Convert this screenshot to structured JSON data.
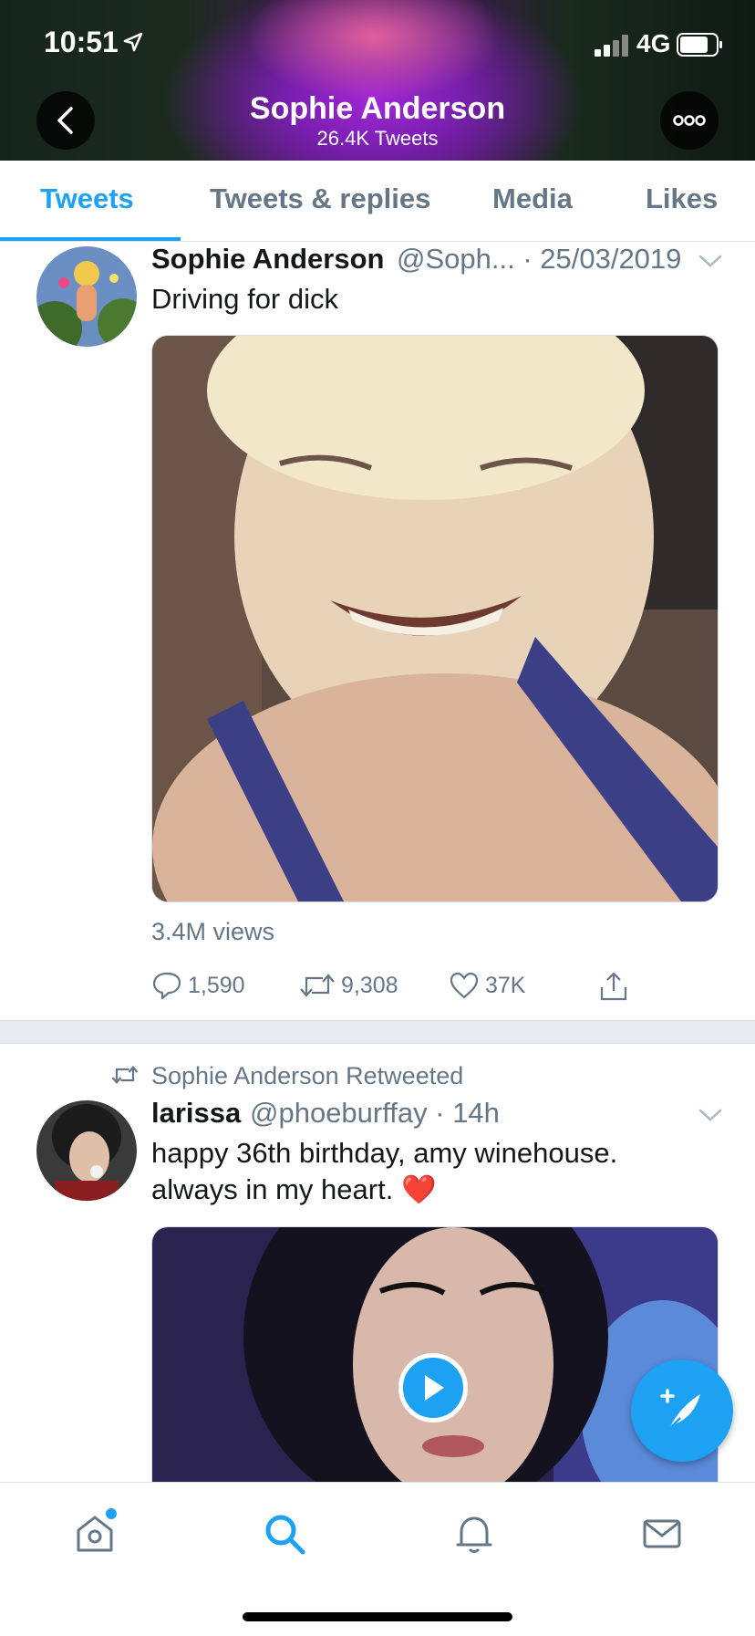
{
  "status_bar": {
    "time": "10:51",
    "network": "4G"
  },
  "header": {
    "name": "Sophie Anderson",
    "tweet_count": "26.4K Tweets"
  },
  "tabs": [
    {
      "label": "Tweets",
      "active": true
    },
    {
      "label": "Tweets & replies"
    },
    {
      "label": "Media"
    },
    {
      "label": "Likes"
    }
  ],
  "tweets": [
    {
      "author": "Sophie Anderson",
      "handle_time": "@Soph... · 25/03/2019",
      "text": "Driving for dick",
      "views": "3.4M views",
      "replies": "1,590",
      "retweets": "9,308",
      "likes": "37K"
    },
    {
      "retweeted_by": "Sophie Anderson Retweeted",
      "author": "larissa",
      "handle_time": "@phoeburffay · 14h",
      "text_line1": "happy 36th birthday, amy winehouse.",
      "text_line2": "always in my heart.",
      "emoji": "❤️"
    }
  ],
  "colors": {
    "accent": "#1da1f2",
    "secondary_text": "#657786"
  }
}
